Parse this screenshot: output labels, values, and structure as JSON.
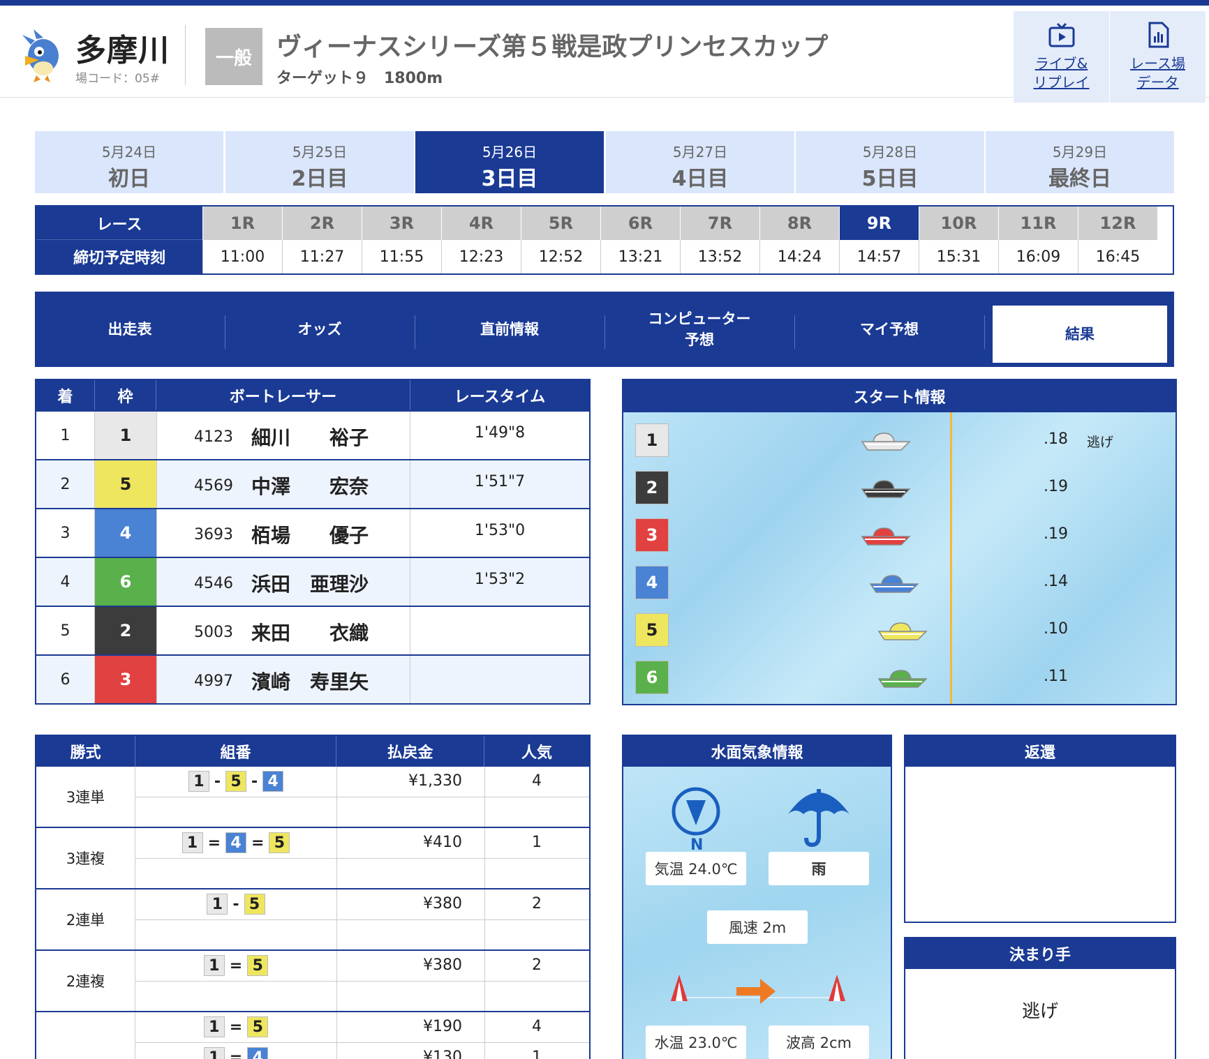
{
  "header": {
    "venue_name": "多摩川",
    "venue_code": "場コード：05#",
    "grade": "一般",
    "race_title": "ヴィーナスシリーズ第５戦是政プリンセスカップ",
    "race_sub": "ターゲット９　1800m",
    "buttons": [
      {
        "label": "ライブ&\nリプレイ",
        "icon": "tv-play-icon"
      },
      {
        "label": "レース場\nデータ",
        "icon": "document-chart-icon"
      }
    ]
  },
  "days": [
    {
      "date": "5月24日",
      "name": "初日",
      "active": false
    },
    {
      "date": "5月25日",
      "name": "2日目",
      "active": false
    },
    {
      "date": "5月26日",
      "name": "3日目",
      "active": true
    },
    {
      "date": "5月27日",
      "name": "4日目",
      "active": false
    },
    {
      "date": "5月28日",
      "name": "5日目",
      "active": false
    },
    {
      "date": "5月29日",
      "name": "最終日",
      "active": false
    }
  ],
  "race_table": {
    "race_label": "レース",
    "time_label": "締切予定時刻",
    "races": [
      {
        "num": "1R",
        "time": "11:00"
      },
      {
        "num": "2R",
        "time": "11:27"
      },
      {
        "num": "3R",
        "time": "11:55"
      },
      {
        "num": "4R",
        "time": "12:23"
      },
      {
        "num": "5R",
        "time": "12:52"
      },
      {
        "num": "6R",
        "time": "13:21"
      },
      {
        "num": "7R",
        "time": "13:52"
      },
      {
        "num": "8R",
        "time": "14:24"
      },
      {
        "num": "9R",
        "time": "14:57",
        "active": true
      },
      {
        "num": "10R",
        "time": "15:31"
      },
      {
        "num": "11R",
        "time": "16:09"
      },
      {
        "num": "12R",
        "time": "16:45"
      }
    ]
  },
  "nav": [
    {
      "label": "出走表"
    },
    {
      "label": "オッズ"
    },
    {
      "label": "直前情報"
    },
    {
      "label": "コンピューター\n予想"
    },
    {
      "label": "マイ予想"
    },
    {
      "label": "結果",
      "active": true
    }
  ],
  "result": {
    "headers": [
      "着",
      "枠",
      "ボートレーサー",
      "レースタイム"
    ],
    "rows": [
      {
        "rank": "1",
        "waku": "1",
        "reg": "4123",
        "name": "細川　　裕子",
        "time": "1'49\"8"
      },
      {
        "rank": "2",
        "waku": "5",
        "reg": "4569",
        "name": "中澤　　宏奈",
        "time": "1'51\"7"
      },
      {
        "rank": "3",
        "waku": "4",
        "reg": "3693",
        "name": "栢場　　優子",
        "time": "1'53\"0"
      },
      {
        "rank": "4",
        "waku": "6",
        "reg": "4546",
        "name": "浜田　亜理沙",
        "time": "1'53\"2"
      },
      {
        "rank": "5",
        "waku": "2",
        "reg": "5003",
        "name": "来田　　衣織",
        "time": ""
      },
      {
        "rank": "6",
        "waku": "3",
        "reg": "4997",
        "name": "濱崎　寿里矢",
        "time": ""
      }
    ]
  },
  "start_info": {
    "title": "スタート情報",
    "rows": [
      {
        "lane": "1",
        "st": ".18",
        "note": "逃げ"
      },
      {
        "lane": "2",
        "st": ".19",
        "note": ""
      },
      {
        "lane": "3",
        "st": ".19",
        "note": ""
      },
      {
        "lane": "4",
        "st": ".14",
        "note": ""
      },
      {
        "lane": "5",
        "st": ".10",
        "note": ""
      },
      {
        "lane": "6",
        "st": ".11",
        "note": ""
      }
    ]
  },
  "payout": {
    "headers": [
      "勝式",
      "組番",
      "払戻金",
      "人気"
    ],
    "rows": [
      {
        "type": "3連単",
        "combo": [
          "1",
          "-",
          "5",
          "-",
          "4"
        ],
        "amount": "¥1,330",
        "pop": "4"
      },
      {
        "type": "3連複",
        "combo": [
          "1",
          "=",
          "4",
          "=",
          "5"
        ],
        "amount": "¥410",
        "pop": "1"
      },
      {
        "type": "2連単",
        "combo": [
          "1",
          "-",
          "5"
        ],
        "amount": "¥380",
        "pop": "2"
      },
      {
        "type": "2連複",
        "combo": [
          "1",
          "=",
          "5"
        ],
        "amount": "¥380",
        "pop": "2"
      },
      {
        "type": "",
        "combo": [
          "1",
          "=",
          "5"
        ],
        "amount": "¥190",
        "pop": "4"
      },
      {
        "type": "",
        "combo": [
          "1",
          "=",
          "4"
        ],
        "amount": "¥130",
        "pop": "1"
      }
    ]
  },
  "weather": {
    "title": "水面気象情報",
    "wind_dir_label": "N",
    "temp": "気温 24.0℃",
    "weather": "雨",
    "wind_speed": "風速 2m",
    "water_temp": "水温 23.0℃",
    "wave": "波高 2cm"
  },
  "refund": {
    "title": "返還"
  },
  "kimarite": {
    "title": "決まり手",
    "value": "逃げ"
  },
  "colors": {
    "navy": "#1a3a94",
    "lane1": "#e8e8e8",
    "lane2": "#3c3c3c",
    "lane3": "#e24141",
    "lane4": "#4a82d4",
    "lane5": "#efe660",
    "lane6": "#5ab14b"
  }
}
